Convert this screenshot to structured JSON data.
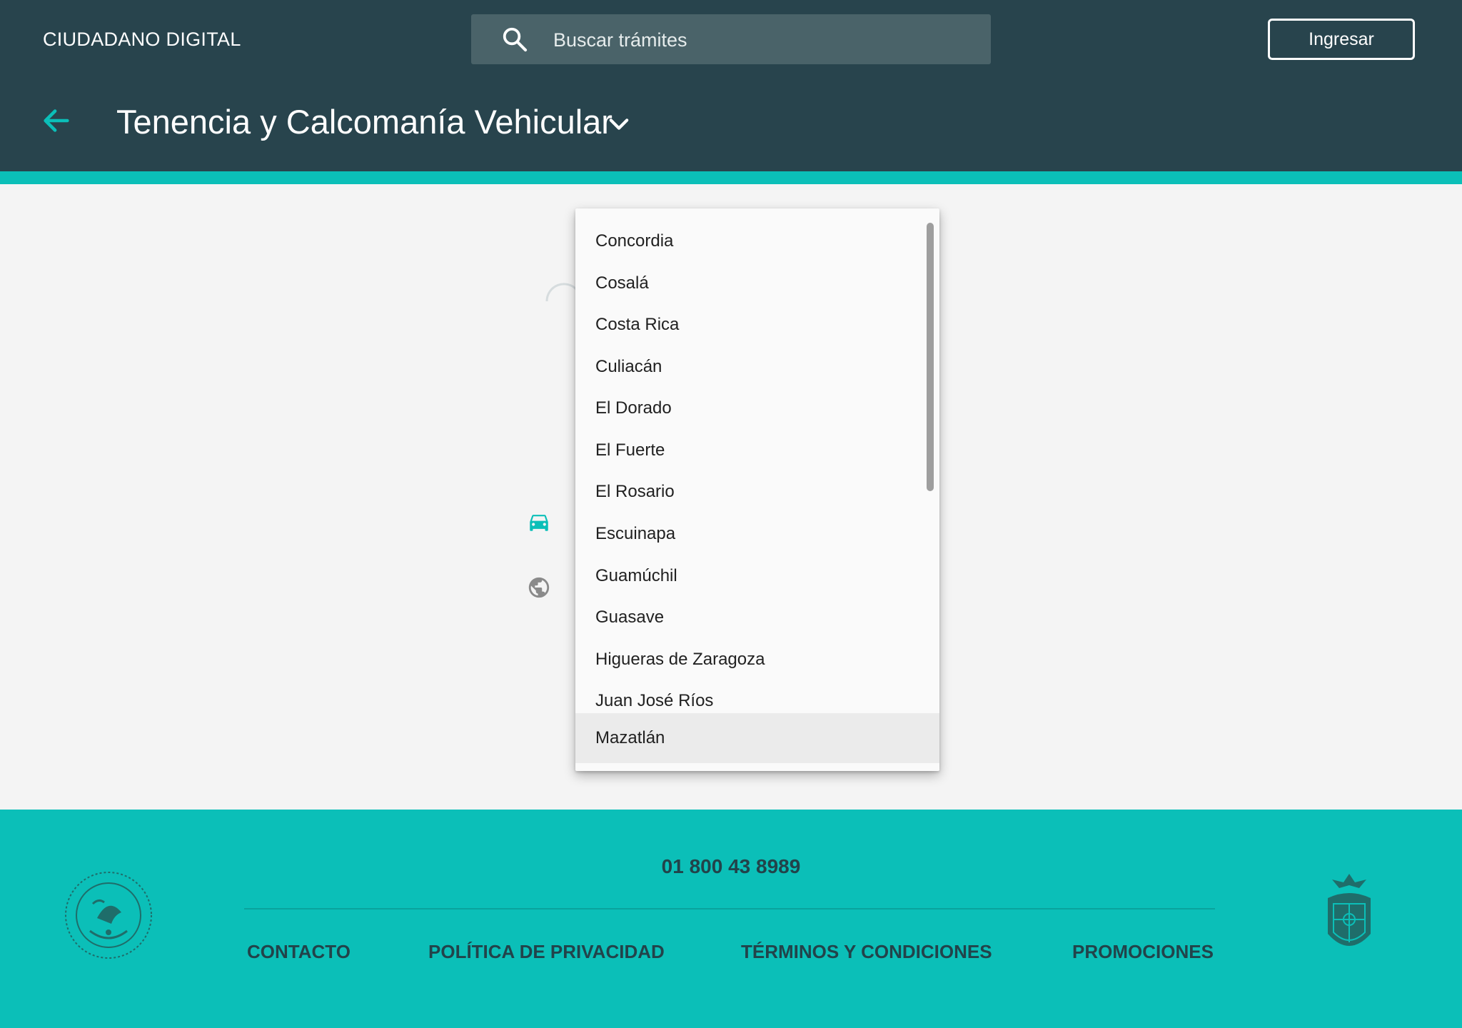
{
  "header": {
    "brand": "CIUDADANO DIGITAL",
    "search_placeholder": "Buscar trámites",
    "login_label": "Ingresar",
    "page_title": "Tenencia y Calcomanía Vehicular"
  },
  "dropdown": {
    "options": [
      "Concordia",
      "Cosalá",
      "Costa Rica",
      "Culiacán",
      "El Dorado",
      "El Fuerte",
      "El Rosario",
      "Escuinapa",
      "Guamúchil",
      "Guasave",
      "Higueras de Zaragoza",
      "Juan José Ríos",
      "Mazatlán"
    ],
    "highlighted": "Mazatlán"
  },
  "footer": {
    "phone": "01 800 43 8989",
    "links": [
      "CONTACTO",
      "POLÍTICA DE PRIVACIDAD",
      "TÉRMINOS Y CONDICIONES",
      "PROMOCIONES"
    ]
  },
  "colors": {
    "header_bg": "#28444d",
    "accent": "#0bbfb8",
    "footer_text": "#22434a"
  },
  "icons": [
    "search-icon",
    "back-arrow-icon",
    "chevron-down-icon",
    "car-icon",
    "globe-icon",
    "mexico-seal-icon",
    "sinaloa-seal-icon"
  ]
}
